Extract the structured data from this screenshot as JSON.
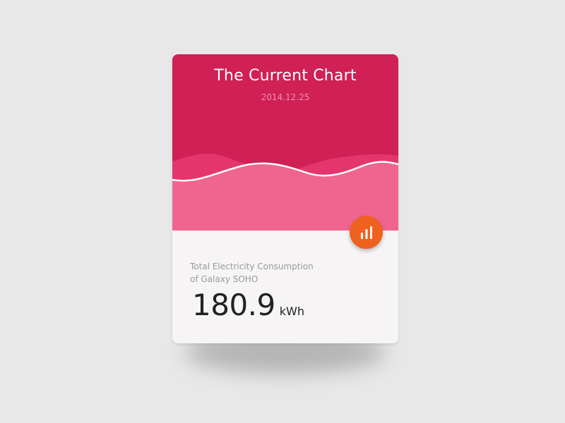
{
  "card": {
    "title": "The Current Chart",
    "date": "2014.12.25",
    "description_line1": "Total Electricity Consumption",
    "description_line2": "of  Galaxy SOHO",
    "value": "180.9",
    "unit": "kWh"
  },
  "icons": {
    "chart_button": "bar-chart-icon"
  },
  "colors": {
    "header": "#d02055",
    "wave_back": "#e4366e",
    "wave_front": "#ef6590",
    "wave_line": "#ffffff",
    "button": "#f0611f",
    "card_bottom": "#f6f4f5",
    "background": "#e8e8e8"
  }
}
